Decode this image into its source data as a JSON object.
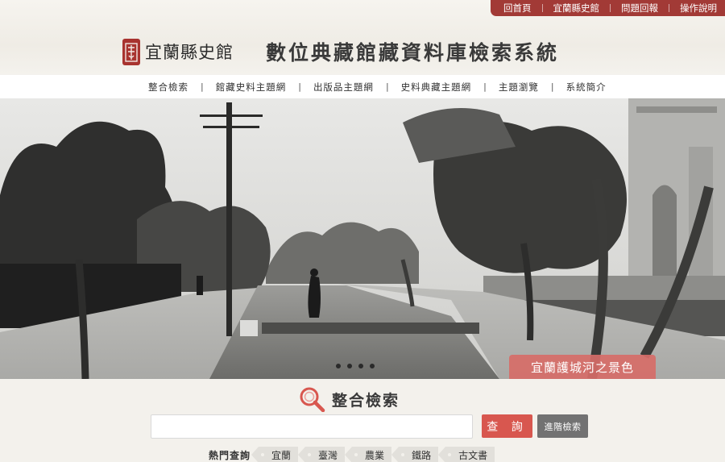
{
  "topbar": {
    "links": [
      "回首頁",
      "宜蘭縣史館",
      "問題回報",
      "操作說明"
    ]
  },
  "brand": {
    "logo_text": "宜蘭縣史館",
    "site_title": "數位典藏館藏資料庫檢索系統",
    "seal_color": "#a8332f"
  },
  "nav": {
    "items": [
      "整合檢索",
      "館藏史料主題網",
      "出版品主題網",
      "史料典藏主題網",
      "主題瀏覽",
      "系統簡介"
    ]
  },
  "banner": {
    "caption": "宜蘭護城河之景色",
    "slide_count": 4
  },
  "search": {
    "heading": "整合檢索",
    "input_value": "",
    "placeholder": "",
    "query_label": "查 詢",
    "advanced_label": "進階檢索",
    "hot_label": "熱門查詢",
    "hot_tags": [
      "宜蘭",
      "臺灣",
      "農業",
      "鐵路",
      "古文書"
    ]
  },
  "colors": {
    "accent": "#a23a36",
    "query_button": "#d8574f",
    "advanced_button": "#727272",
    "caption_bg": "#d66c68"
  },
  "icons": {
    "search_heading": "magnifier-icon",
    "logo": "seal-icon"
  }
}
